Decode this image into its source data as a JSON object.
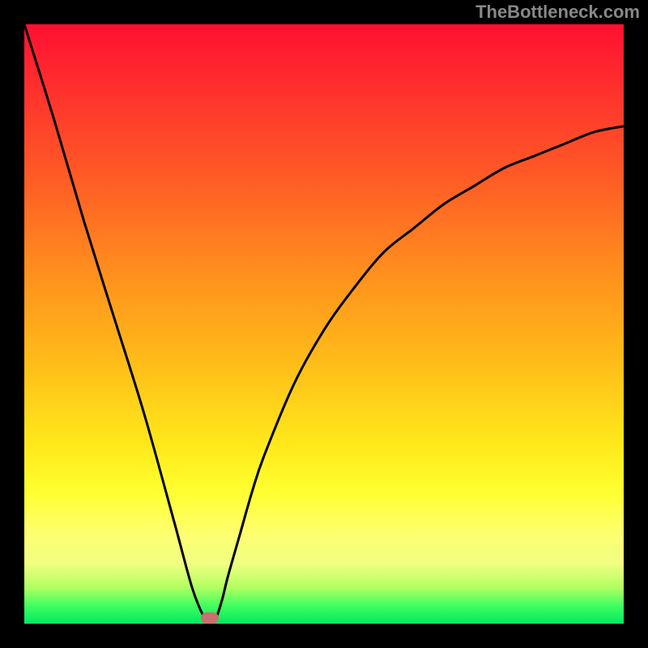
{
  "watermark": "TheBottleneck.com",
  "chart_data": {
    "type": "line",
    "title": "",
    "xlabel": "",
    "ylabel": "",
    "xlim": [
      0,
      100
    ],
    "ylim": [
      0,
      100
    ],
    "series": [
      {
        "name": "bottleneck-curve",
        "x": [
          0,
          5,
          10,
          15,
          20,
          25,
          28,
          30,
          31,
          32,
          33,
          34,
          36,
          38,
          40,
          45,
          50,
          55,
          60,
          65,
          70,
          75,
          80,
          85,
          90,
          95,
          100
        ],
        "values": [
          100,
          84,
          67,
          51,
          35,
          17,
          6,
          1,
          0,
          1,
          4,
          8,
          15,
          22,
          28,
          40,
          49,
          56,
          62,
          66,
          70,
          73,
          76,
          78,
          80,
          82,
          83
        ]
      }
    ],
    "annotations": [
      {
        "name": "indicator-dot",
        "x": 31,
        "y": 1
      }
    ]
  },
  "colors": {
    "frame": "#000000",
    "curve": "#000000",
    "indicator": "#cc6f6f",
    "gradient_top": "#ff1030",
    "gradient_mid": "#ffe81a",
    "gradient_bottom": "#00e860"
  }
}
